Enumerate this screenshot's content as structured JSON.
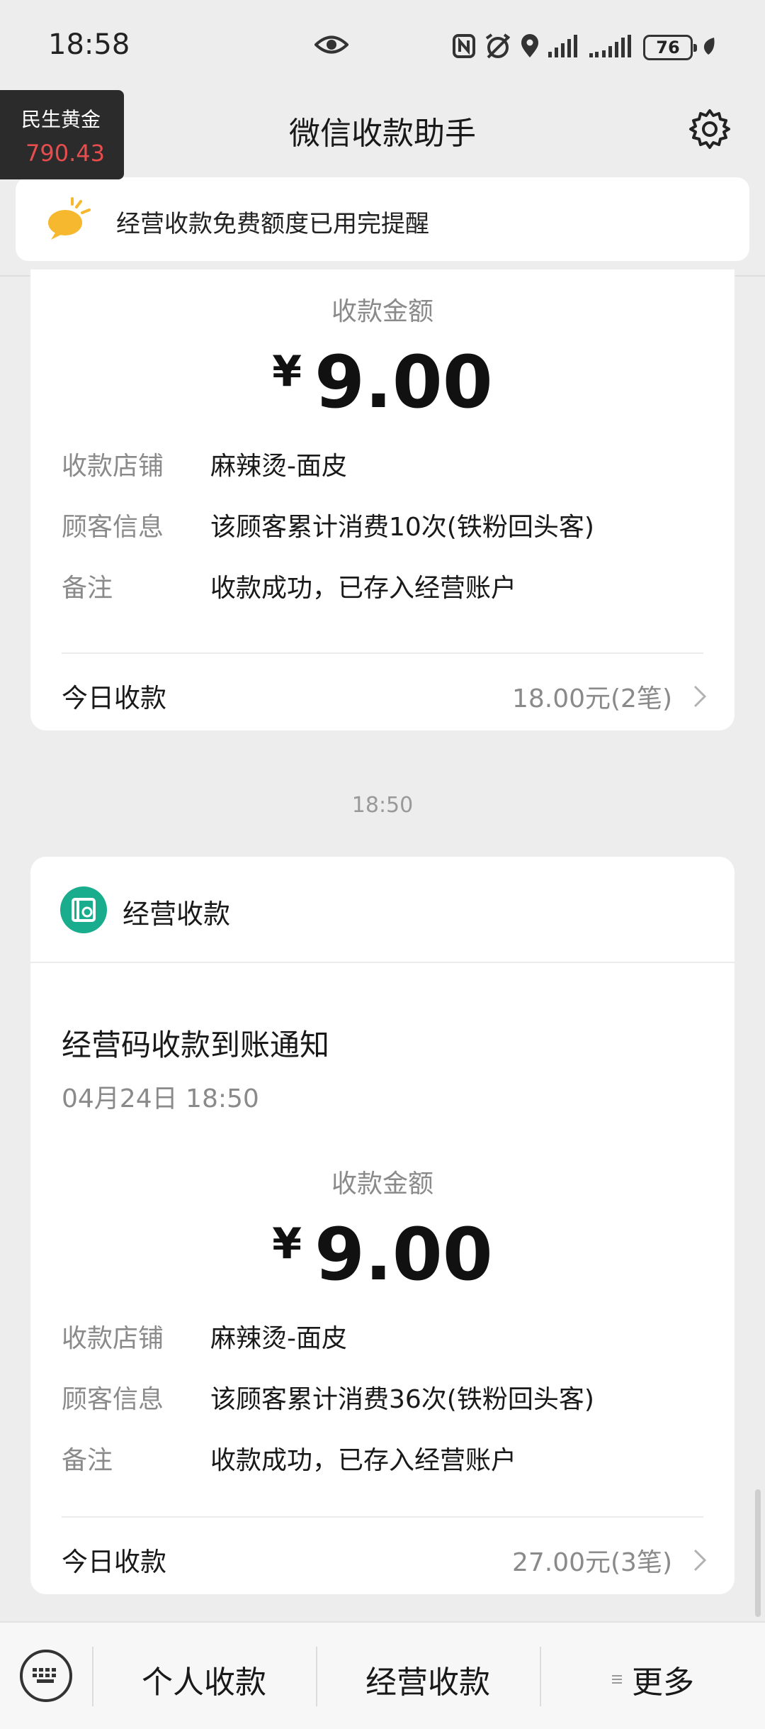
{
  "status_bar": {
    "time": "18:58",
    "battery": "76"
  },
  "header": {
    "title": "微信收款助手"
  },
  "ticker": {
    "name": "民生黄金",
    "price": "790.43"
  },
  "notice": {
    "text": "经营收款免费额度已用完提醒"
  },
  "card1": {
    "amount_label": "收款金额",
    "currency": "¥",
    "amount": "9.00",
    "rows": [
      {
        "key": "收款店铺",
        "value": "麻辣烫-面皮"
      },
      {
        "key": "顾客信息",
        "value": "该顾客累计消费10次(铁粉回头客)"
      },
      {
        "key": "备注",
        "value": "收款成功，已存入经营账户"
      }
    ],
    "today_label": "今日收款",
    "today_value": "18.00元(2笔)"
  },
  "time_divider": "18:50",
  "card2": {
    "brand": "经营收款",
    "title": "经营码收款到账通知",
    "date": "04月24日 18:50",
    "amount_label": "收款金额",
    "currency": "¥",
    "amount": "9.00",
    "rows": [
      {
        "key": "收款店铺",
        "value": "麻辣烫-面皮"
      },
      {
        "key": "顾客信息",
        "value": "该顾客累计消费36次(铁粉回头客)"
      },
      {
        "key": "备注",
        "value": "收款成功，已存入经营账户"
      }
    ],
    "today_label": "今日收款",
    "today_value": "27.00元(3笔)"
  },
  "bottom_bar": {
    "items": [
      "个人收款",
      "经营收款",
      "更多"
    ]
  },
  "colors": {
    "brand_green": "#1aad8d",
    "ticker_red": "#e84d4d",
    "notice_yellow": "#f5b82e"
  }
}
